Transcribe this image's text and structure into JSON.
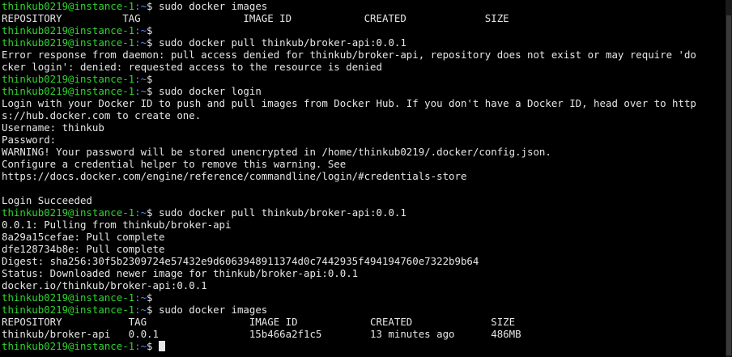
{
  "prompt": {
    "user_host": "thinkub0219@instance-1",
    "path": ":~",
    "symbol": "$"
  },
  "lines": [
    {
      "type": "prompt",
      "cmd": " sudo docker images"
    },
    {
      "type": "out",
      "text": "REPOSITORY          TAG                 IMAGE ID            CREATED             SIZE"
    },
    {
      "type": "prompt",
      "cmd": ""
    },
    {
      "type": "prompt",
      "cmd": " sudo docker pull thinkub/broker-api:0.0.1"
    },
    {
      "type": "out",
      "text": "Error response from daemon: pull access denied for thinkub/broker-api, repository does not exist or may require 'do"
    },
    {
      "type": "out",
      "text": "cker login': denied: requested access to the resource is denied"
    },
    {
      "type": "prompt",
      "cmd": ""
    },
    {
      "type": "prompt",
      "cmd": " sudo docker login"
    },
    {
      "type": "out",
      "text": "Login with your Docker ID to push and pull images from Docker Hub. If you don't have a Docker ID, head over to http"
    },
    {
      "type": "out",
      "text": "s://hub.docker.com to create one."
    },
    {
      "type": "out",
      "text": "Username: thinkub"
    },
    {
      "type": "out",
      "text": "Password:"
    },
    {
      "type": "out",
      "text": "WARNING! Your password will be stored unencrypted in /home/thinkub0219/.docker/config.json."
    },
    {
      "type": "out",
      "text": "Configure a credential helper to remove this warning. See"
    },
    {
      "type": "out",
      "text": "https://docs.docker.com/engine/reference/commandline/login/#credentials-store"
    },
    {
      "type": "out",
      "text": ""
    },
    {
      "type": "out",
      "text": "Login Succeeded"
    },
    {
      "type": "prompt",
      "cmd": " sudo docker pull thinkub/broker-api:0.0.1"
    },
    {
      "type": "out",
      "text": "0.0.1: Pulling from thinkub/broker-api"
    },
    {
      "type": "out",
      "text": "8a29a15cefae: Pull complete"
    },
    {
      "type": "out",
      "text": "dfe128734b8e: Pull complete"
    },
    {
      "type": "out",
      "text": "Digest: sha256:30f5b2309724e57432e9d6063948911374d0c7442935f494194760e7322b9b64"
    },
    {
      "type": "out",
      "text": "Status: Downloaded newer image for thinkub/broker-api:0.0.1"
    },
    {
      "type": "out",
      "text": "docker.io/thinkub/broker-api:0.0.1"
    },
    {
      "type": "prompt",
      "cmd": ""
    },
    {
      "type": "prompt",
      "cmd": " sudo docker images"
    },
    {
      "type": "out",
      "text": "REPOSITORY           TAG                 IMAGE ID            CREATED             SIZE"
    },
    {
      "type": "out",
      "text": "thinkub/broker-api   0.0.1               15b466a2f1c5        13 minutes ago      486MB"
    },
    {
      "type": "prompt",
      "cmd": " ",
      "cursor": true
    }
  ],
  "colors": {
    "background": "#000000",
    "text": "#e6e6e6",
    "prompt_user": "#2fd52f",
    "prompt_path": "#5b8cff"
  }
}
